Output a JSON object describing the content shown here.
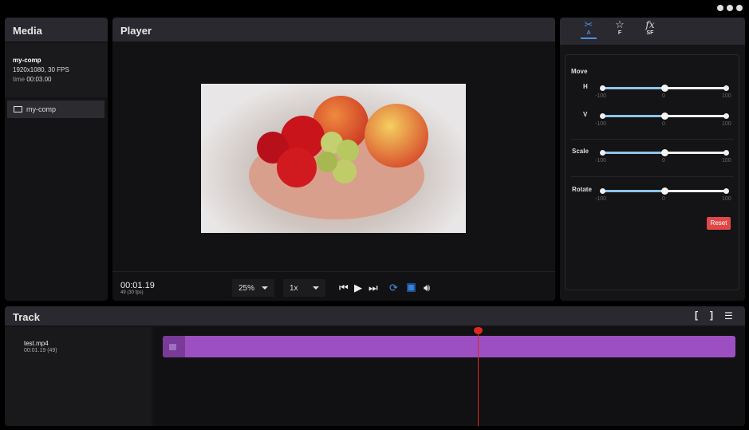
{
  "window": {
    "controls": [
      "minimize",
      "maximize",
      "close"
    ]
  },
  "media": {
    "title": "Media",
    "comp_name": "my-comp",
    "resolution": "1920x1080, 30 FPS",
    "time_label": "time",
    "time_value": "00:03.00",
    "items": [
      {
        "label": "my-comp",
        "icon": "film-icon"
      }
    ]
  },
  "player": {
    "title": "Player",
    "timecode": "00:01.19",
    "frame_info": "49 (30 fps)",
    "zoom": "25%",
    "speed": "1x"
  },
  "properties": {
    "tabs": [
      {
        "label": "A",
        "icon": "scissors-icon",
        "active": true
      },
      {
        "label": "F",
        "icon": "star-icon"
      },
      {
        "label": "SF",
        "icon": "fx-icon"
      }
    ],
    "section": "Move",
    "sliders": [
      {
        "label": "H",
        "value": 0,
        "min": "-100",
        "mid": "0",
        "max": "100"
      },
      {
        "label": "V",
        "value": 0,
        "min": "-100",
        "mid": "0",
        "max": "100"
      },
      {
        "label": "Scale",
        "value": 0,
        "min": "-100",
        "mid": "0",
        "max": "100"
      },
      {
        "label": "Rotate",
        "value": 0,
        "min": "-100",
        "mid": "0",
        "max": "100"
      }
    ],
    "reset": "Reset"
  },
  "track": {
    "title": "Track",
    "clip_name": "test.mp4",
    "clip_time": "00:01.19 (49)",
    "playhead_fraction": 0.55
  },
  "colors": {
    "accent": "#4a90e2",
    "clip": "#9b4fc0",
    "playhead": "#e0281e",
    "reset": "#e04848"
  }
}
